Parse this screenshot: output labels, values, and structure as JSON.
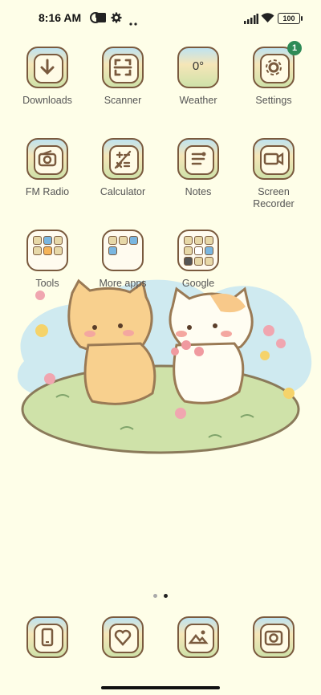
{
  "status": {
    "time": "8:16 AM",
    "battery": "100",
    "icons": [
      "data-saver-icon",
      "stop-icon",
      "gear-icon",
      "more-icon",
      "signal-icon",
      "wifi-icon",
      "battery-icon"
    ]
  },
  "apps": [
    {
      "label": "Downloads",
      "icon": "download-icon"
    },
    {
      "label": "Scanner",
      "icon": "scanner-icon"
    },
    {
      "label": "Weather",
      "icon": "weather-icon",
      "value": "0°"
    },
    {
      "label": "Settings",
      "icon": "gear-icon",
      "badge": "1"
    },
    {
      "label": "FM Radio",
      "icon": "radio-icon"
    },
    {
      "label": "Calculator",
      "icon": "calculator-icon"
    },
    {
      "label": "Notes",
      "icon": "notes-icon"
    },
    {
      "label": "Screen Recorder",
      "icon": "screen-recorder-icon"
    }
  ],
  "folders": [
    {
      "label": "Tools"
    },
    {
      "label": "More apps"
    },
    {
      "label": "Google"
    }
  ],
  "dock": [
    {
      "icon": "phone-icon"
    },
    {
      "icon": "messages-icon"
    },
    {
      "icon": "gallery-icon"
    },
    {
      "icon": "camera-icon"
    }
  ],
  "pager": {
    "pages": 2,
    "current": 2
  },
  "colors": {
    "background": "#fefee8",
    "badge": "#2e8b57",
    "icon_outline": "#7a5a3e"
  }
}
